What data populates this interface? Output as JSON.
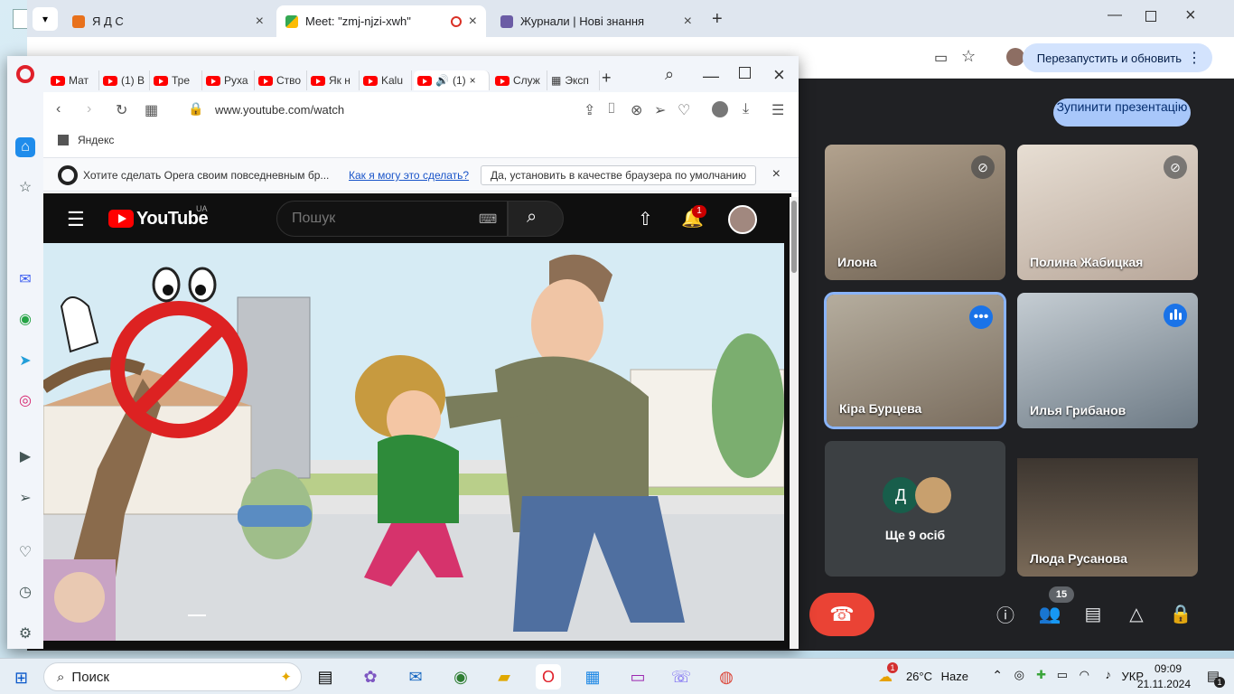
{
  "chrome": {
    "tabs": [
      {
        "title": "Я Д С",
        "icon": "contact-icon"
      },
      {
        "title": "Meet: \"zmj-njzi-xwh\"",
        "icon": "meet-icon"
      },
      {
        "title": "Журнали | Нові знання",
        "icon": "nz-icon"
      }
    ],
    "relaunch_label": "Перезапустить и обновить"
  },
  "meet": {
    "stop_presenting": "Зупинити презентацію",
    "participants": [
      {
        "name": "Илона",
        "state": "muted"
      },
      {
        "name": "Полина Жабицкая",
        "state": "muted"
      },
      {
        "name": "Кіра Бурцева",
        "state": "more"
      },
      {
        "name": "Илья Грибанов",
        "state": "speaking"
      },
      {
        "name": "Люда Русанова",
        "state": "none"
      }
    ],
    "more_people": {
      "label": "Ще 9 осіб",
      "avatar_letter": "Д"
    },
    "people_count": "15"
  },
  "opera": {
    "tabs": [
      "Мат",
      "(1) В",
      "Тре",
      "Руха",
      "Ство",
      "Як н",
      "Kalu",
      "(1)",
      "Служ",
      "Эксп"
    ],
    "address": "www.youtube.com/watch",
    "bookmark": "Яндекс",
    "infobar": {
      "text": "Хотите сделать Opera своим повседневным бр...",
      "link": "Как я могу это сделать?",
      "button": "Да, установить в качестве браузера по умолчанию"
    }
  },
  "youtube": {
    "logo": "YouTube",
    "region": "UA",
    "search_placeholder": "Пошук",
    "notification_count": "1"
  },
  "taskbar": {
    "search_label": "Поиск",
    "weather_temp": "26°C",
    "weather_desc": "Haze",
    "weather_badge": "1",
    "language": "УКР",
    "time": "09:09",
    "date": "21.11.2024",
    "notification_badge": "1"
  }
}
